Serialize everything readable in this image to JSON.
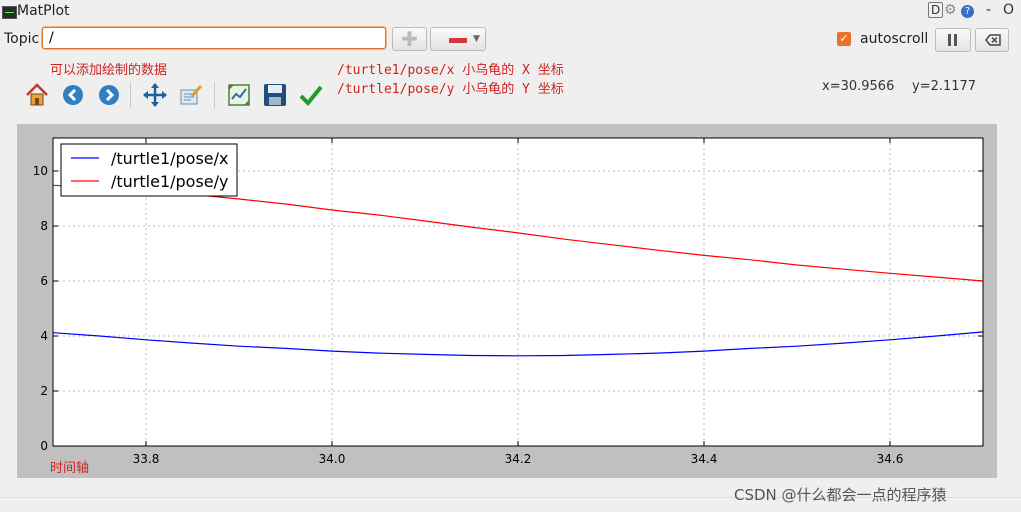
{
  "window": {
    "title": "MatPlot",
    "controls": [
      "D",
      "?",
      "-",
      "O"
    ]
  },
  "topic": {
    "label": "Topic",
    "value": "/"
  },
  "autoscroll": {
    "label": "autoscroll",
    "checked": true
  },
  "annotations": {
    "add_plot_note": "可以添加绘制的数据",
    "x_note": "/turtle1/pose/x 小乌龟的 X 坐标",
    "y_note": "/turtle1/pose/y 小乌龟的 Y 坐标",
    "time_axis_note": "时间轴"
  },
  "cursor": {
    "x": "x=30.9566",
    "y": "y=2.1177"
  },
  "toolbar": {
    "icons": [
      "home-icon",
      "back-icon",
      "forward-icon",
      "pan-icon",
      "edit-curves-icon",
      "subplot-config-icon",
      "save-icon",
      "check-icon"
    ]
  },
  "watermark": "CSDN @什么都会一点的程序猿",
  "chart_data": {
    "type": "line",
    "x_ticks": [
      33.8,
      34.0,
      34.2,
      34.4,
      34.6
    ],
    "y_ticks": [
      0,
      2,
      4,
      6,
      8,
      10
    ],
    "xlim": [
      33.7,
      34.7
    ],
    "ylim": [
      0,
      11.2
    ],
    "grid": true,
    "legend_position": "top-left",
    "series": [
      {
        "name": "/turtle1/pose/x",
        "color": "#0000ff",
        "x": [
          33.7,
          33.75,
          33.8,
          33.85,
          33.9,
          33.95,
          34.0,
          34.05,
          34.1,
          34.15,
          34.2,
          34.25,
          34.3,
          34.35,
          34.4,
          34.45,
          34.5,
          34.55,
          34.6,
          34.65,
          34.7
        ],
        "y": [
          4.12,
          4.0,
          3.86,
          3.74,
          3.63,
          3.55,
          3.45,
          3.38,
          3.33,
          3.29,
          3.28,
          3.29,
          3.33,
          3.38,
          3.45,
          3.55,
          3.63,
          3.74,
          3.86,
          4.0,
          4.15
        ]
      },
      {
        "name": "/turtle1/pose/y",
        "color": "#ff0000",
        "x": [
          33.7,
          33.75,
          33.8,
          33.85,
          33.9,
          33.95,
          34.0,
          34.05,
          34.1,
          34.15,
          34.2,
          34.25,
          34.3,
          34.35,
          34.4,
          34.45,
          34.5,
          34.55,
          34.6,
          34.65,
          34.7
        ],
        "y": [
          9.48,
          9.4,
          9.28,
          9.15,
          8.98,
          8.8,
          8.58,
          8.4,
          8.18,
          7.96,
          7.75,
          7.52,
          7.32,
          7.12,
          6.93,
          6.77,
          6.58,
          6.43,
          6.28,
          6.14,
          6.0
        ]
      }
    ]
  }
}
